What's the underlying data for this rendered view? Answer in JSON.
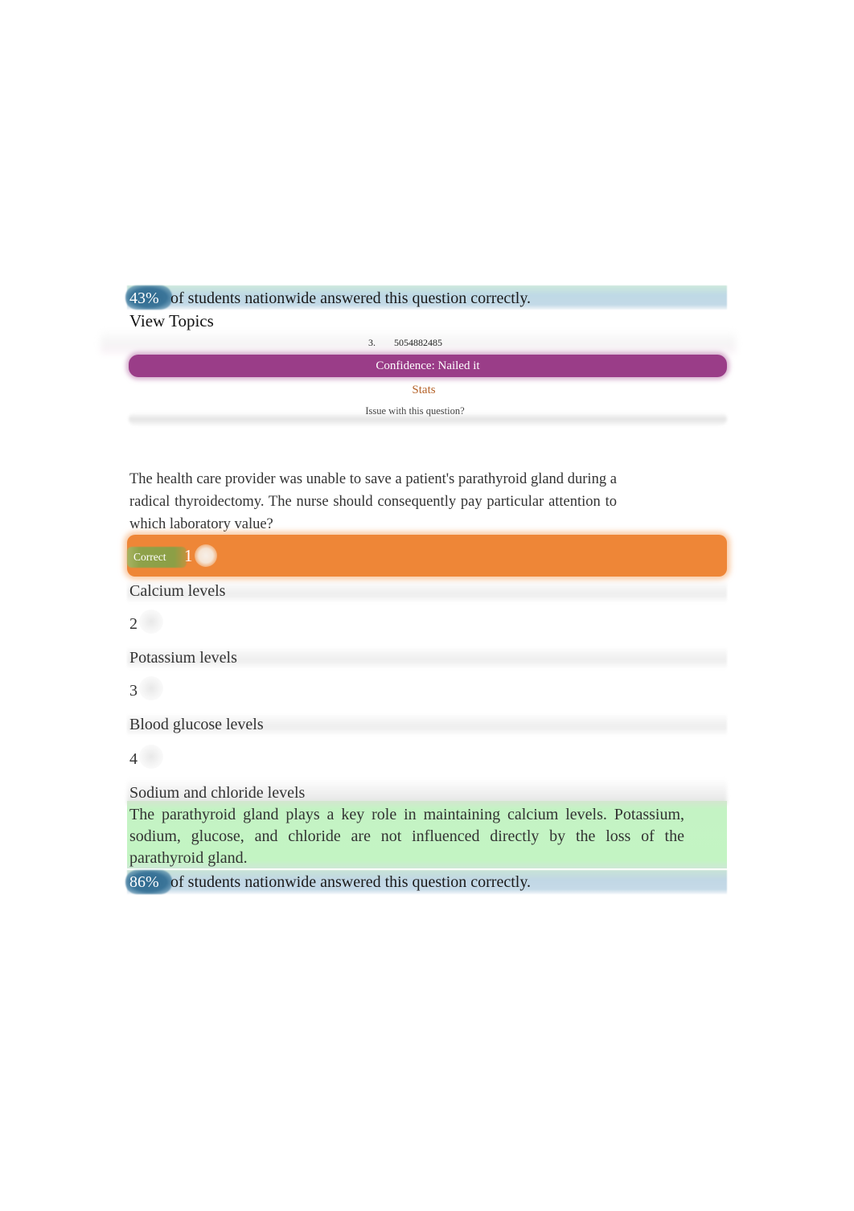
{
  "top_stats": {
    "percent": "43%",
    "text": "of students nationwide answered this question correctly."
  },
  "view_topics": "View Topics",
  "question_header": {
    "number": "3.",
    "id": "5054882485",
    "confidence": "Confidence: Nailed it",
    "stats_link": "Stats",
    "issue_link": "Issue with this question?"
  },
  "question": {
    "text": "The health care provider was unable to save a patient's parathyroid gland during a radical thyroidectomy. The nurse should consequently pay particular attention to which laboratory value?",
    "correct_label": "Correct",
    "options": [
      {
        "number": "1",
        "text": "Calcium levels",
        "selected": true,
        "correct": true
      },
      {
        "number": "2",
        "text": "Potassium levels",
        "selected": false,
        "correct": false
      },
      {
        "number": "3",
        "text": "Blood glucose levels",
        "selected": false,
        "correct": false
      },
      {
        "number": "4",
        "text": "Sodium and chloride levels",
        "selected": false,
        "correct": false
      }
    ],
    "explanation": "The parathyroid gland plays a key role in maintaining calcium levels. Potassium, sodium, glucose, and chloride are not influenced directly by the loss of the parathyroid gland."
  },
  "bottom_stats": {
    "percent": "86%",
    "text": "of students nationwide answered this question correctly."
  },
  "colors": {
    "confidence": "#9a3d88",
    "selected_answer": "#ee8637",
    "correct_badge": "#8c9f46",
    "explanation_bg": "#c3f4c3",
    "stats_bg": "#c3d9e7",
    "percent_badge": "#3b7599",
    "stats_link": "#b5632a"
  }
}
